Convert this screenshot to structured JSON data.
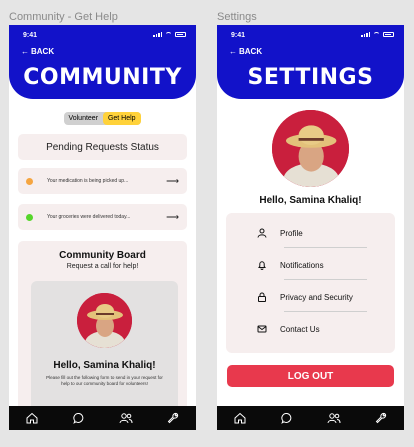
{
  "frames": {
    "left_label": "Community - Get Help",
    "right_label": "Settings"
  },
  "status_bar": {
    "time": "9:41"
  },
  "community": {
    "back_label": "BACK",
    "title": "COMMUNITY",
    "toggle": {
      "volunteer": "Volunteer",
      "get_help": "Get Help",
      "selected": "Get Help"
    },
    "pending_title": "Pending Requests Status",
    "requests": [
      {
        "text": "Your medication is being picked up...",
        "status_color": "#f5a540"
      },
      {
        "text": "Your groceries were delivered today...",
        "status_color": "#56d62b"
      }
    ],
    "board": {
      "title": "Community Board",
      "subtitle": "Request a call for help!",
      "hello": "Hello, Samina Khaliq!",
      "note": "Please fill out the following form to send in your request for help to our community board for volunteers!"
    }
  },
  "settings": {
    "back_label": "BACK",
    "title": "SETTINGS",
    "hello": "Hello, Samina Khaliq!",
    "items": [
      {
        "label": "Profile",
        "icon": "user-icon"
      },
      {
        "label": "Notifications",
        "icon": "bell-icon"
      },
      {
        "label": "Privacy and Security",
        "icon": "lock-icon"
      },
      {
        "label": "Contact Us",
        "icon": "mail-icon"
      }
    ],
    "logout_label": "LOG OUT"
  },
  "tabbar": [
    "home-icon",
    "chat-icon",
    "people-icon",
    "wrench-icon"
  ],
  "colors": {
    "brand_blue": "#1212c9",
    "accent_yellow": "#ffd23a",
    "logout_red": "#e8394d",
    "card_bg": "#f6eeee",
    "avatar_bg": "#c91f3d"
  }
}
